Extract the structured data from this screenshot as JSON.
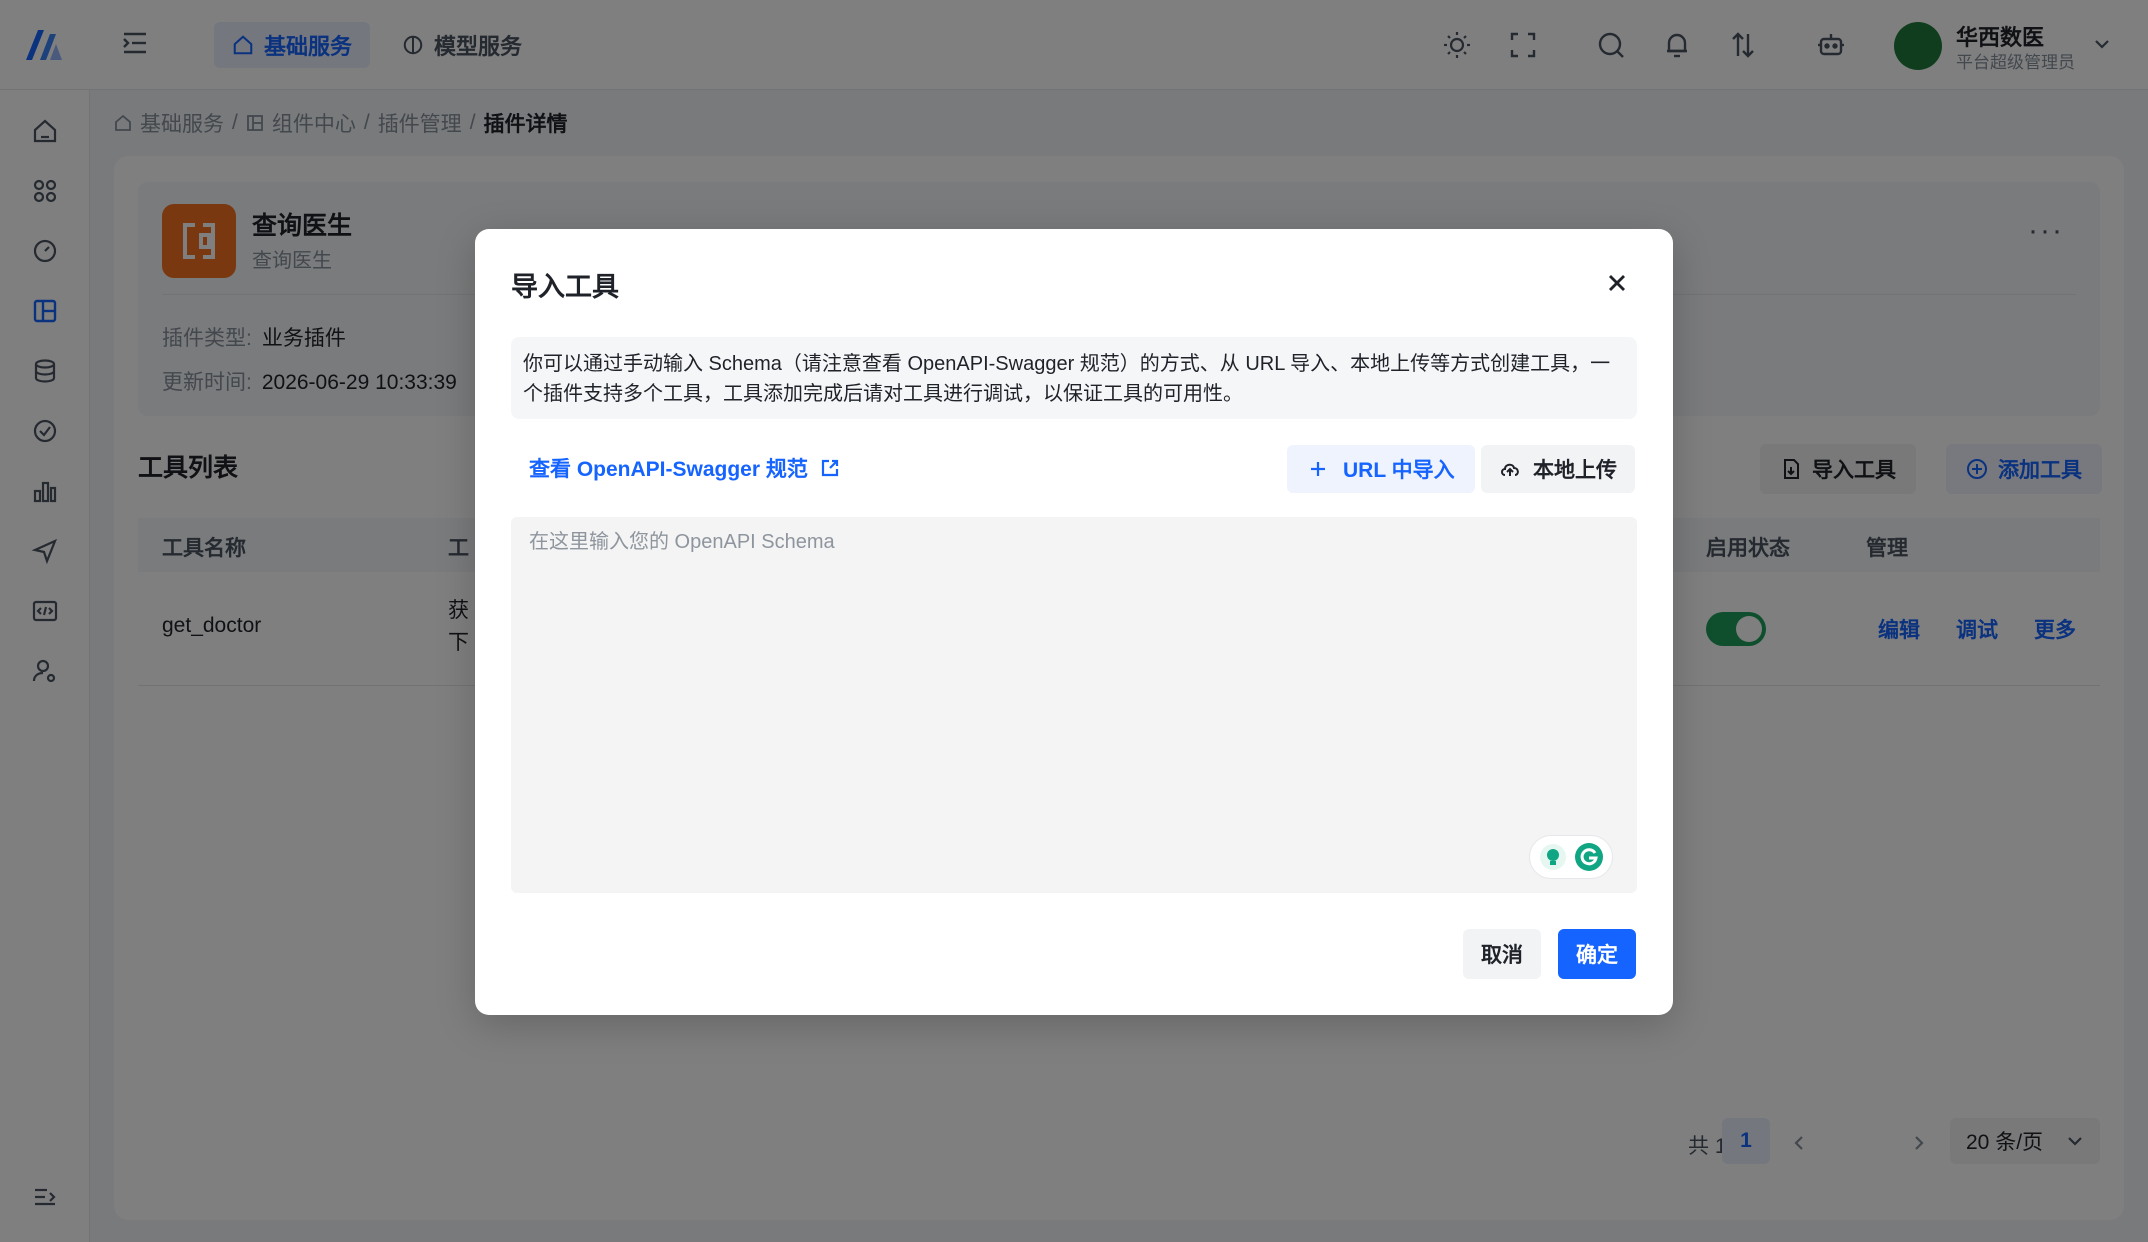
{
  "colors": {
    "primary": "#1664ff",
    "toggle_on": "#1e9e5a",
    "plugin_logo": "#f37021"
  },
  "topbar": {
    "tabs": [
      {
        "label": "基础服务",
        "icon": "home-icon",
        "active": true
      },
      {
        "label": "模型服务",
        "icon": "model-icon",
        "active": false
      }
    ],
    "user": {
      "name": "华西数医",
      "role": "平台超级管理员"
    }
  },
  "breadcrumb": {
    "items": [
      "基础服务",
      "组件中心",
      "插件管理"
    ],
    "current": "插件详情",
    "separator": "/"
  },
  "plugin": {
    "name": "查询医生",
    "subtitle": "查询医生",
    "type_label": "插件类型:",
    "type_value": "业务插件",
    "updated_label": "更新时间:",
    "updated_value": "2026-06-29 10:33:39",
    "more": "···"
  },
  "tools": {
    "title": "工具列表",
    "import_button": "导入工具",
    "add_button": "添加工具",
    "columns": [
      "工具名称",
      "工",
      "启用状态",
      "管理"
    ],
    "rows": [
      {
        "name": "get_doctor",
        "desc_line1": "获",
        "desc_line2": "下",
        "enabled": true,
        "actions": [
          "编辑",
          "调试",
          "更多"
        ]
      }
    ]
  },
  "pagination": {
    "total": "共 1 条",
    "current_page": "1",
    "page_size": "20 条/页"
  },
  "modal": {
    "title": "导入工具",
    "description": "你可以通过手动输入 Schema（请注意查看 OpenAPI-Swagger 规范）的方式、从 URL 导入、本地上传等方式创建工具，一个插件支持多个工具，工具添加完成后请对工具进行调试，以保证工具的可用性。",
    "swagger_link": "查看 OpenAPI-Swagger 规范",
    "url_import_button": "URL 中导入",
    "local_upload_button": "本地上传",
    "schema_placeholder": "在这里输入您的 OpenAPI Schema",
    "schema_value": "",
    "cancel_button": "取消",
    "ok_button": "确定"
  }
}
